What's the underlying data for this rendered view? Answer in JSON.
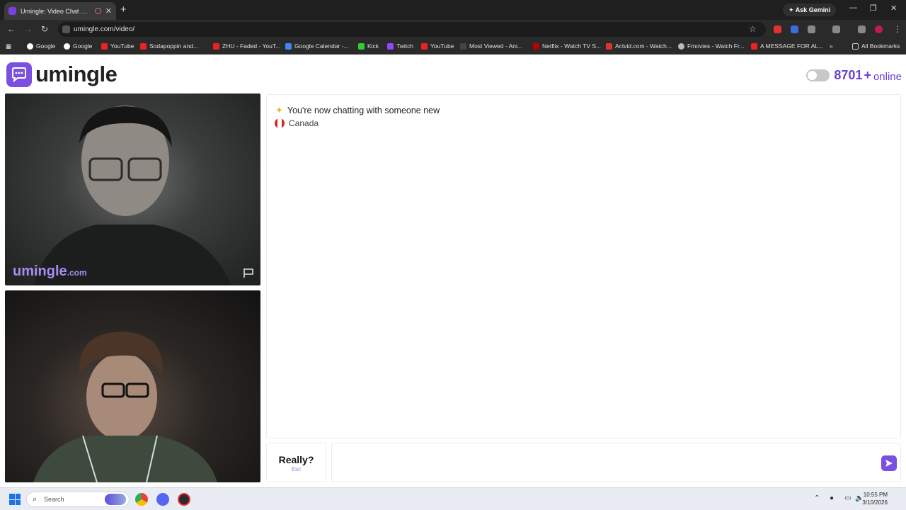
{
  "browser": {
    "tab_title": "Umingle: Video Chat with St",
    "new_tab": "+",
    "gemini": "Ask Gemini",
    "url": "umingle.com/video/",
    "bookmarks": [
      "Google",
      "Google",
      "YouTube",
      "Sodapoppin and...",
      "ZHU - Faded - YouT...",
      "Google Calendar -...",
      "Kick",
      "Twitch",
      "YouTube",
      "Most Viewed - Ani...",
      "Netflix - Watch TV S...",
      "Actvid.com - Watch...",
      "Fmovies - Watch Fr...",
      "A MESSAGE FOR AL..."
    ],
    "all_bookmarks": "All Bookmarks"
  },
  "header": {
    "brand": "umingle",
    "online_count": "8701",
    "online_plus": "+",
    "online_label": "online"
  },
  "videos": {
    "watermark": "umingle",
    "watermark_suffix": ".com"
  },
  "chat": {
    "system_message": "You're now chatting with someone new",
    "country": "Canada",
    "really_label": "Really?",
    "really_shortcut": "Esc",
    "input_value": ""
  },
  "taskbar": {
    "search_placeholder": "Search",
    "time": "10:55 PM",
    "date": "3/10/2026"
  },
  "colors": {
    "brand_purple": "#7b4fe0",
    "online_purple": "#6a3fd6"
  }
}
